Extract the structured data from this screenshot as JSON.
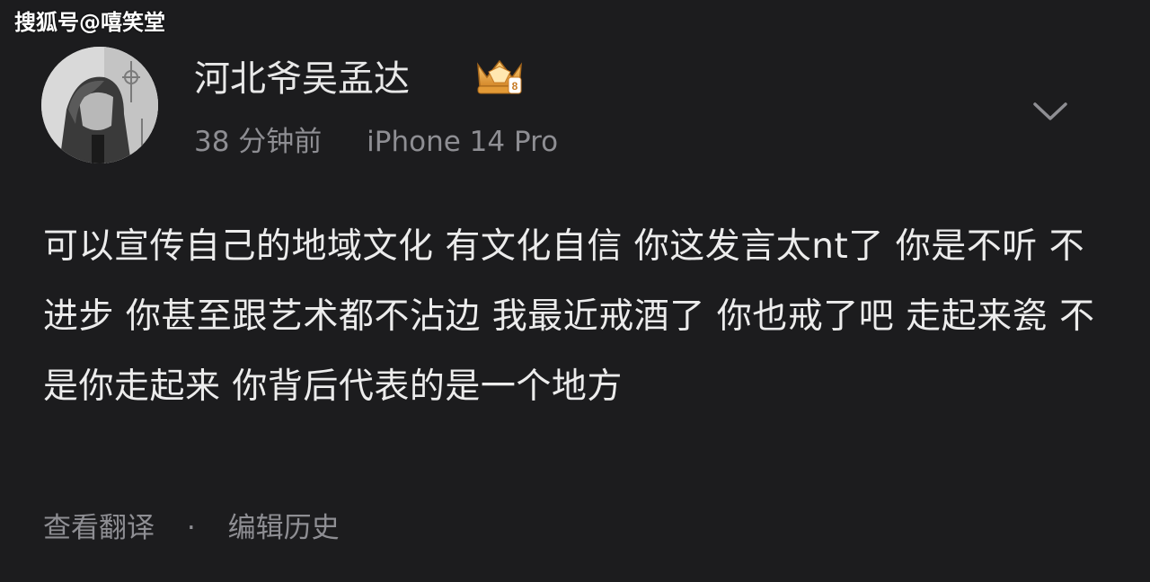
{
  "watermark": "搜狐号@嘻笑堂",
  "post": {
    "author": "河北爷吴孟达",
    "time": "38 分钟前",
    "device": "iPhone 14 Pro",
    "body": "可以宣传自己的地域文化 有文化自信 你这发言太nt了 你是不听 不进步 你甚至跟艺术都不沾边 我最近戒酒了 你也戒了吧 走起来瓷 不是你走起来 你背后代表的是一个地方"
  },
  "footer": {
    "translate": "查看翻译",
    "separator": "·",
    "edit_history": "编辑历史"
  },
  "icons": {
    "badge": "crown-badge-icon",
    "more": "chevron-down-icon"
  },
  "colors": {
    "background": "#1c1c1e",
    "text_primary": "#ececec",
    "text_secondary": "#8e8e93",
    "badge_gold": "#e8a93a"
  }
}
